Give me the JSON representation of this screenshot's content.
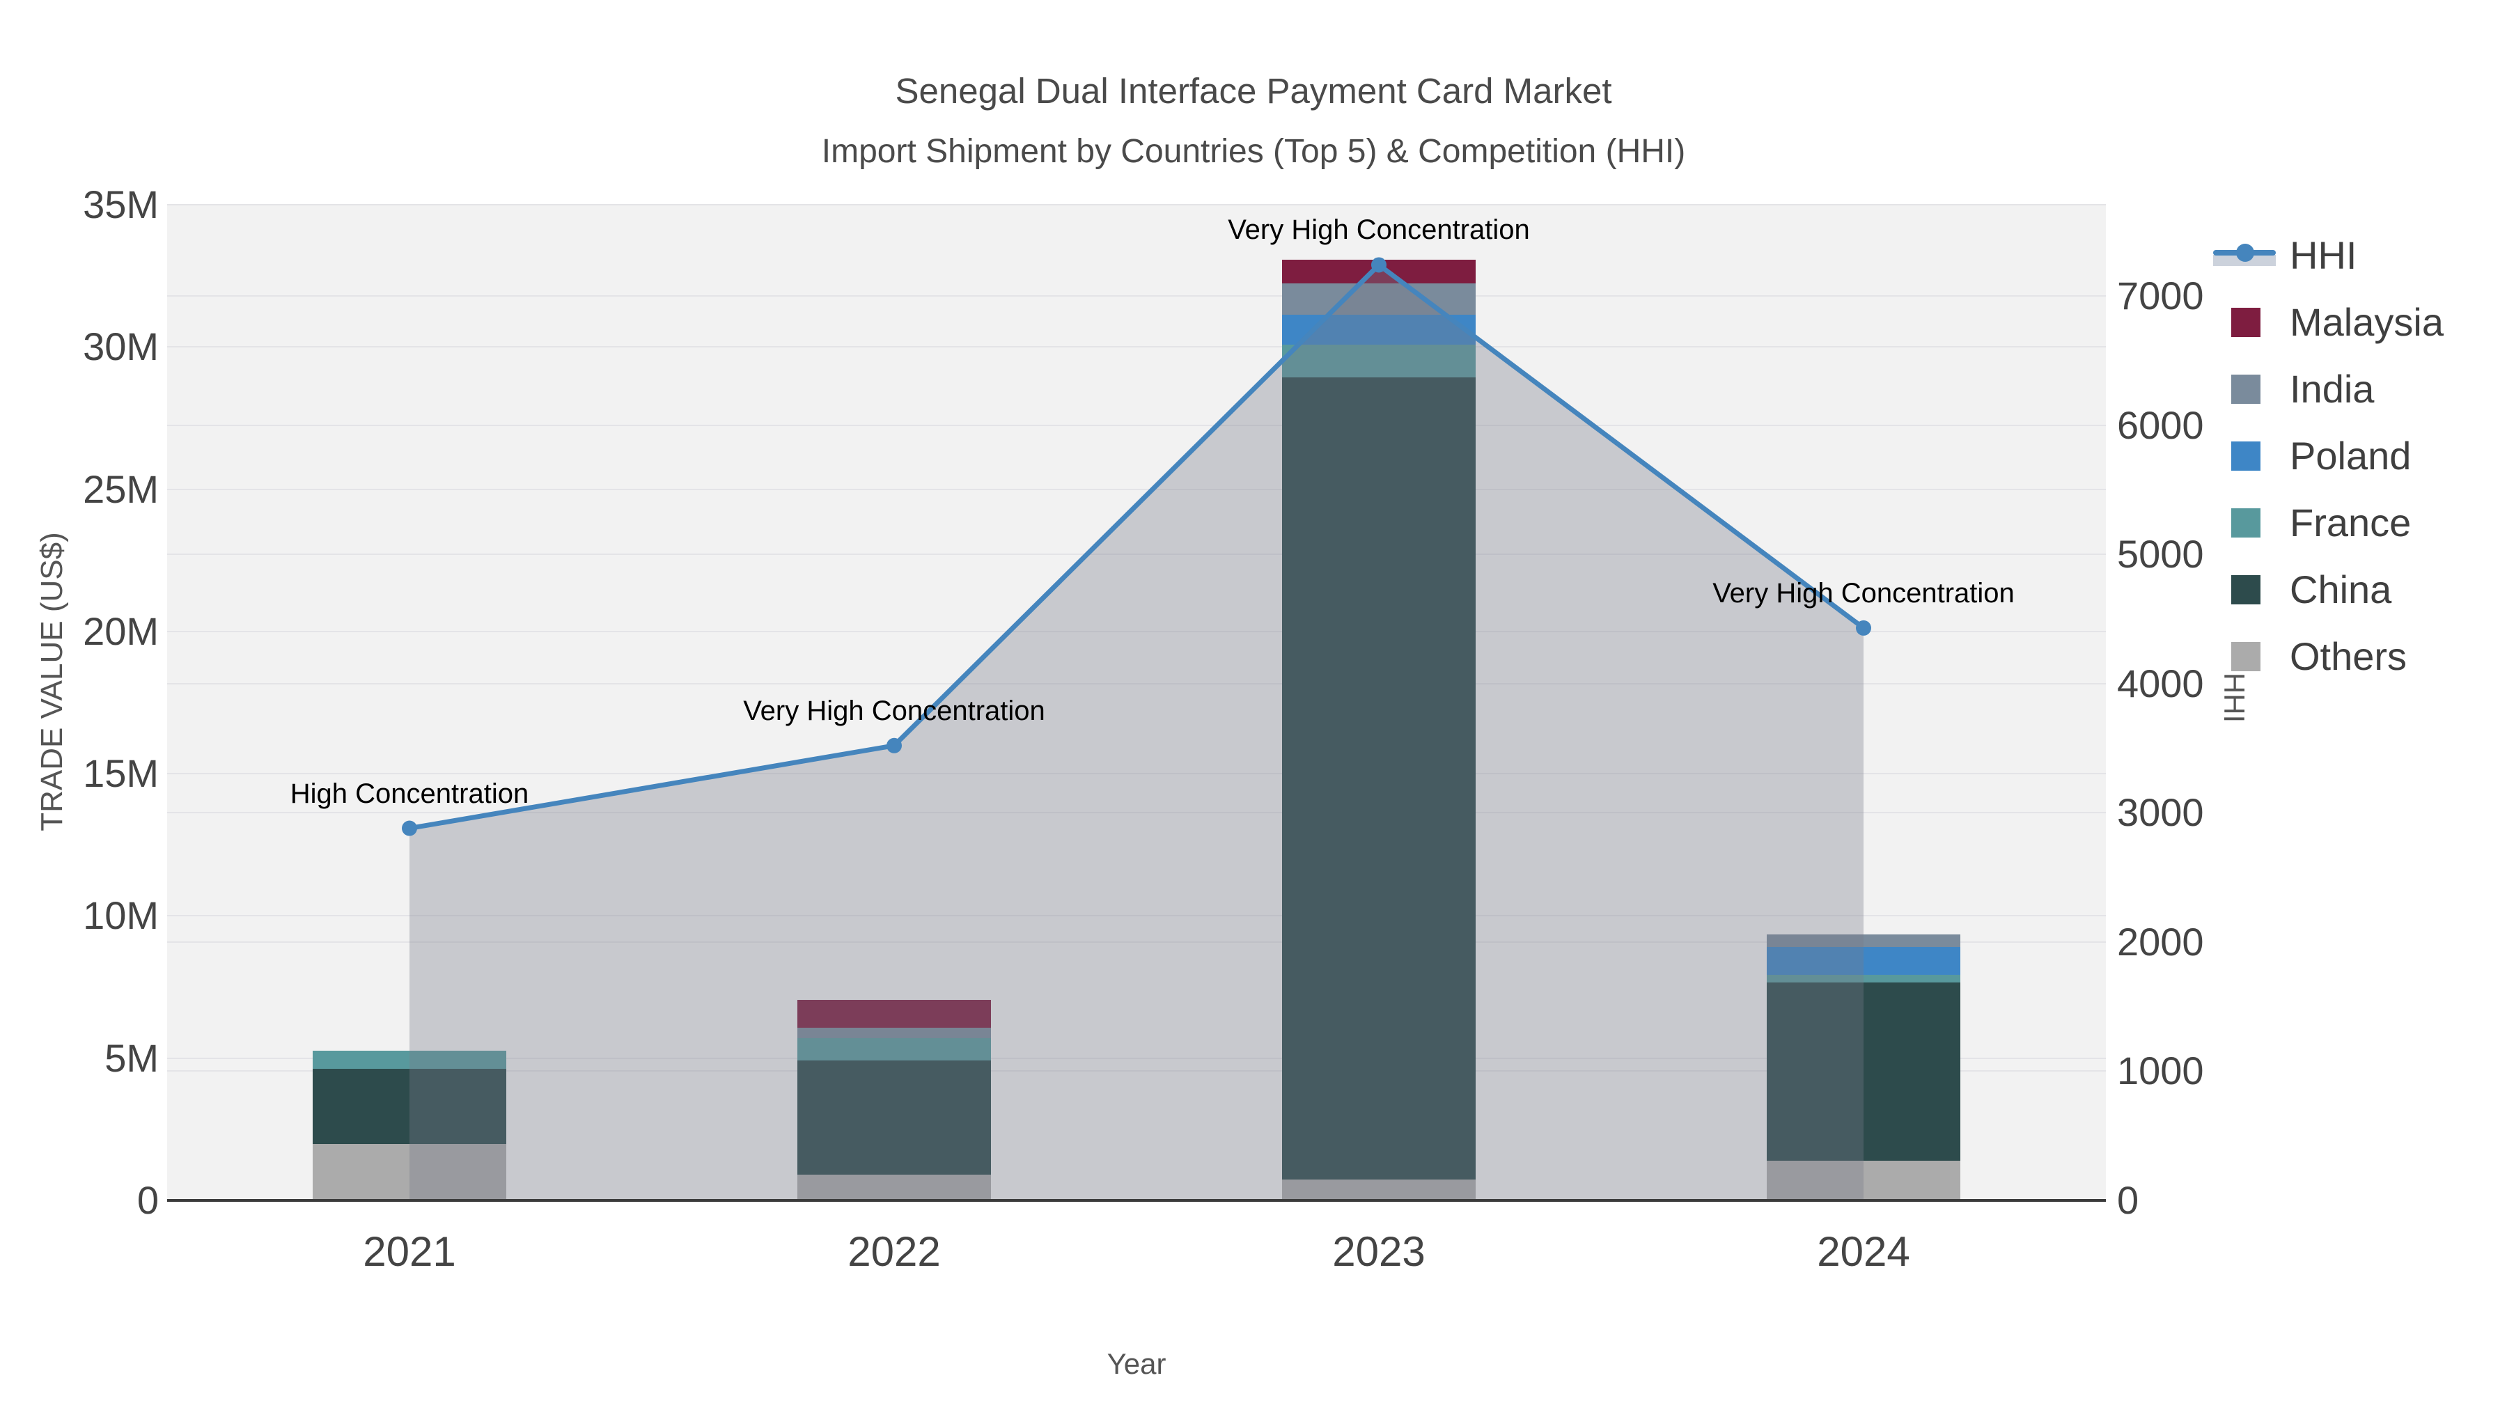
{
  "title": {
    "line1": "Senegal Dual Interface Payment Card Market",
    "line2": "Import Shipment by Countries (Top 5) & Competition (HHI)"
  },
  "axes": {
    "x": {
      "label": "Year"
    },
    "y_left": {
      "label": "TRADE VALUE (US$)",
      "ticks": [
        "0",
        "5M",
        "10M",
        "15M",
        "20M",
        "25M",
        "30M",
        "35M"
      ]
    },
    "y_right": {
      "label": "HHI",
      "ticks": [
        "0",
        "1000",
        "2000",
        "3000",
        "4000",
        "5000",
        "6000",
        "7000"
      ]
    }
  },
  "legend": {
    "items": [
      {
        "label": "HHI",
        "type": "line"
      },
      {
        "label": "Malaysia",
        "type": "swatch",
        "color": "#7e1d40"
      },
      {
        "label": "India",
        "type": "swatch",
        "color": "#7a8b9c"
      },
      {
        "label": "Poland",
        "type": "swatch",
        "color": "#3e86c6"
      },
      {
        "label": "France",
        "type": "swatch",
        "color": "#58999d"
      },
      {
        "label": "China",
        "type": "swatch",
        "color": "#2d4b4c"
      },
      {
        "label": "Others",
        "type": "swatch",
        "color": "#ababab"
      }
    ]
  },
  "colors": {
    "hhi_line": "#4585bd",
    "hhi_area": "rgba(120,124,138,0.34)",
    "malaysia": "#7e1d40",
    "india": "#7a8b9c",
    "poland": "#3e86c6",
    "france": "#58999d",
    "china": "#2d4b4c",
    "others": "#ababab",
    "plot_bg": "#f2f2f2",
    "grid": "#e4e4e7",
    "axis_line": "#3b3b3b"
  },
  "chart_data": {
    "type": "combo-stacked-bar-line",
    "categories": [
      "2021",
      "2022",
      "2023",
      "2024"
    ],
    "bar_unit": "US$ millions",
    "series": [
      {
        "name": "Malaysia",
        "color": "#7e1d40",
        "values": [
          0,
          0.98,
          0.83,
          0
        ]
      },
      {
        "name": "India",
        "color": "#7a8b9c",
        "values": [
          0,
          0.37,
          1.1,
          0.44
        ]
      },
      {
        "name": "Poland",
        "color": "#3e86c6",
        "values": [
          0,
          0,
          1.05,
          1.0
        ]
      },
      {
        "name": "France",
        "color": "#58999d",
        "values": [
          0.64,
          0.78,
          1.17,
          0.27
        ]
      },
      {
        "name": "China",
        "color": "#2d4b4c",
        "values": [
          2.64,
          4.01,
          28.19,
          6.26
        ]
      },
      {
        "name": "Others",
        "color": "#ababab",
        "values": [
          1.98,
          0.91,
          0.73,
          1.39
        ]
      }
    ],
    "bar_totals_m": [
      5.26,
      7.05,
      33.07,
      9.36
    ],
    "line_series": {
      "name": "HHI",
      "color": "#4585bd",
      "values": [
        2880,
        3520,
        7240,
        4430
      ],
      "area": true
    },
    "annotations": [
      "High Concentration",
      "Very High Concentration",
      "Very High Concentration",
      "Very High Concentration"
    ],
    "title": "Senegal Dual Interface Payment Card Market — Import Shipment by Countries (Top 5) & Competition (HHI)",
    "xlabel": "Year",
    "ylabel_left": "TRADE VALUE (US$)",
    "ylabel_right": "HHI",
    "ylim_left_m": [
      0,
      35
    ],
    "y_left_tick_step_m": 5,
    "y_right_ticks": [
      0,
      1000,
      2000,
      3000,
      4000,
      5000,
      6000,
      7000
    ],
    "grid": true,
    "legend_position": "right"
  }
}
